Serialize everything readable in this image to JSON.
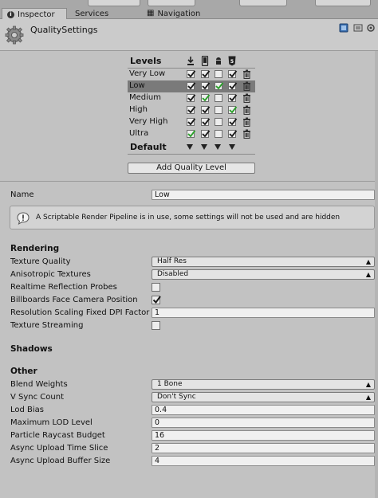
{
  "tabs": [
    {
      "label": "Inspector",
      "icon": "info-icon",
      "active": true
    },
    {
      "label": "Services",
      "active": false
    },
    {
      "label": "Navigation",
      "icon": "navigation-icon",
      "active": false
    }
  ],
  "header": {
    "title": "QualitySettings",
    "icon": "gear-icon"
  },
  "levels": {
    "title": "Levels",
    "platforms": [
      "standalone-download-icon",
      "mobile-phone-icon",
      "android-icon",
      "html5-icon"
    ],
    "rows": [
      {
        "name": "Very Low",
        "checks": [
          true,
          true,
          false,
          true
        ],
        "green": [
          false,
          false,
          false,
          false
        ],
        "selected": false
      },
      {
        "name": "Low",
        "checks": [
          true,
          true,
          true,
          true
        ],
        "green": [
          false,
          false,
          true,
          false
        ],
        "selected": true
      },
      {
        "name": "Medium",
        "checks": [
          true,
          true,
          false,
          true
        ],
        "green": [
          false,
          true,
          false,
          false
        ],
        "selected": false
      },
      {
        "name": "High",
        "checks": [
          true,
          true,
          false,
          true
        ],
        "green": [
          false,
          false,
          false,
          true
        ],
        "selected": false
      },
      {
        "name": "Very High",
        "checks": [
          true,
          true,
          false,
          true
        ],
        "green": [
          false,
          false,
          false,
          false
        ],
        "selected": false
      },
      {
        "name": "Ultra",
        "checks": [
          true,
          true,
          false,
          true
        ],
        "green": [
          true,
          false,
          false,
          false
        ],
        "selected": false
      }
    ],
    "default_label": "Default",
    "add_button": "Add Quality Level"
  },
  "name_field": {
    "label": "Name",
    "value": "Low"
  },
  "help": {
    "text": "A Scriptable Render Pipeline is in use, some settings will not be used and are hidden",
    "icon": "info-icon"
  },
  "rendering": {
    "heading": "Rendering",
    "texture_quality": {
      "label": "Texture Quality",
      "value": "Half Res"
    },
    "anisotropic": {
      "label": "Anisotropic Textures",
      "value": "Disabled"
    },
    "realtime_reflection": {
      "label": "Realtime Reflection Probes",
      "checked": false
    },
    "billboards": {
      "label": "Billboards Face Camera Position",
      "checked": true
    },
    "resolution_scaling": {
      "label": "Resolution Scaling Fixed DPI Factor",
      "value": "1"
    },
    "texture_streaming": {
      "label": "Texture Streaming",
      "checked": false
    }
  },
  "shadows": {
    "heading": "Shadows"
  },
  "other": {
    "heading": "Other",
    "blend_weights": {
      "label": "Blend Weights",
      "value": "1 Bone"
    },
    "vsync": {
      "label": "V Sync Count",
      "value": "Don't Sync"
    },
    "lod_bias": {
      "label": "Lod Bias",
      "value": "0.4"
    },
    "max_lod": {
      "label": "Maximum LOD Level",
      "value": "0"
    },
    "particle_raycast": {
      "label": "Particle Raycast Budget",
      "value": "16"
    },
    "async_time_slice": {
      "label": "Async Upload Time Slice",
      "value": "2"
    },
    "async_buffer": {
      "label": "Async Upload Buffer Size",
      "value": "4"
    }
  },
  "colors": {
    "green_check": "#2aa02a",
    "selected_row": "#7a7a7a",
    "panel": "#c2c2c2"
  }
}
